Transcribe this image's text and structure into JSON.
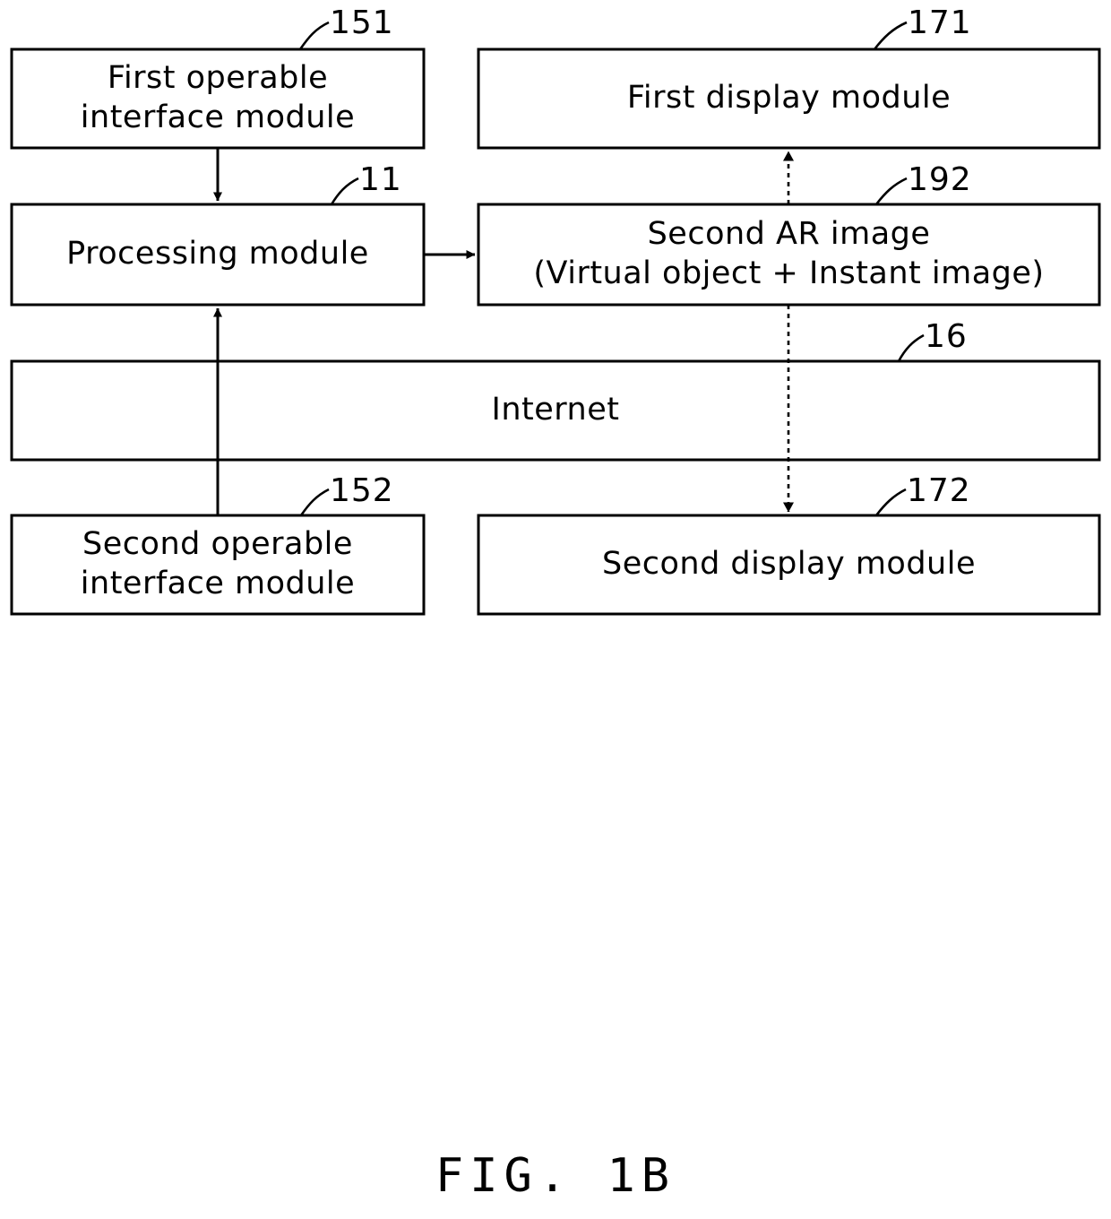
{
  "figure": {
    "caption": "FIG. 1B",
    "type": "patent-block-diagram"
  },
  "blocks": [
    {
      "id": "first-operable-interface-module",
      "ref": "151",
      "lines": [
        "First  operable",
        "interface  module"
      ]
    },
    {
      "id": "first-display-module",
      "ref": "171",
      "lines": [
        "First  display  module"
      ]
    },
    {
      "id": "processing-module",
      "ref": "11",
      "lines": [
        "Processing  module"
      ]
    },
    {
      "id": "second-ar-image",
      "ref": "192",
      "lines": [
        "Second  AR  image",
        "(Virtual  object  +  Instant  image)"
      ]
    },
    {
      "id": "internet",
      "ref": "16",
      "lines": [
        "Internet"
      ]
    },
    {
      "id": "second-operable-interface-module",
      "ref": "152",
      "lines": [
        "Second  operable",
        "interface  module"
      ]
    },
    {
      "id": "second-display-module",
      "ref": "172",
      "lines": [
        "Second  display  module"
      ]
    }
  ],
  "labels": {
    "first_operable_line1": "First  operable",
    "first_operable_line2": "interface  module",
    "first_display": "First  display  module",
    "processing": "Processing  module",
    "second_ar_line1": "Second  AR  image",
    "second_ar_line2": "(Virtual  object  +  Instant  image)",
    "internet": "Internet",
    "second_operable_line1": "Second  operable",
    "second_operable_line2": "interface  module",
    "second_display": "Second  display  module"
  },
  "refs": {
    "first_operable": "151",
    "first_display": "171",
    "processing": "11",
    "second_ar": "192",
    "internet": "16",
    "second_operable": "152",
    "second_display": "172"
  },
  "colors": {
    "stroke": "#000000",
    "background": "#ffffff",
    "text": "#000000"
  }
}
